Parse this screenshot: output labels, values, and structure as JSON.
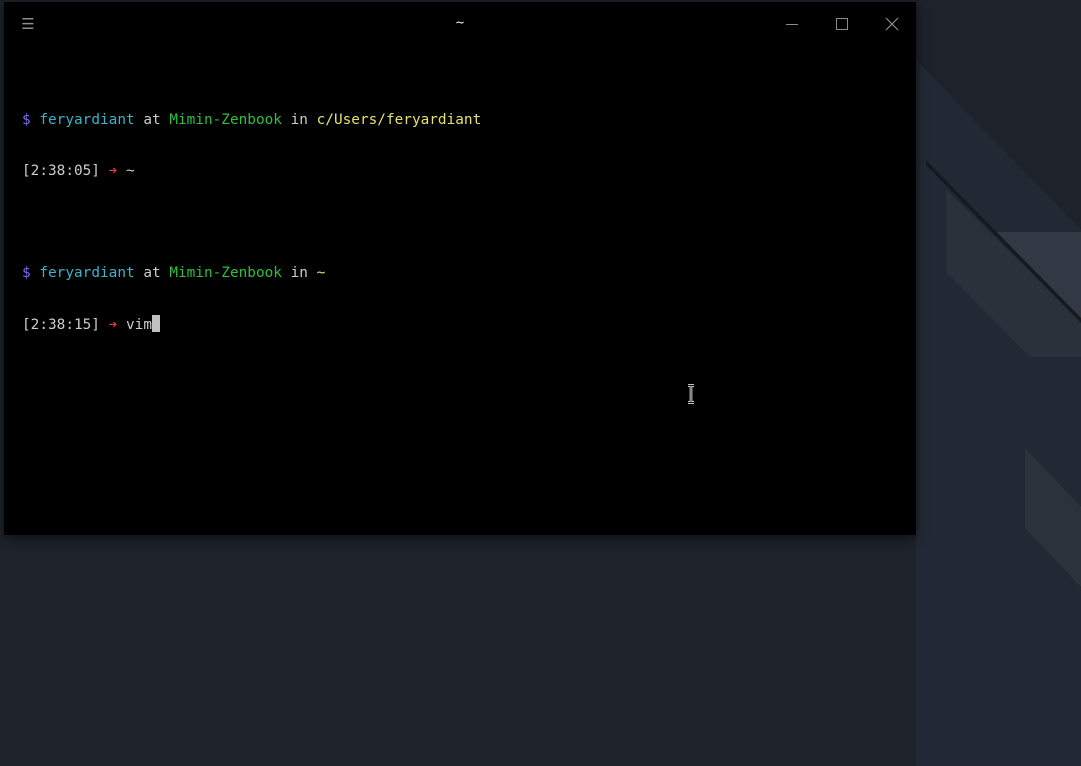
{
  "window": {
    "title": "~",
    "menu_icon": "hamburger-menu-icon",
    "controls": [
      "minimize-icon",
      "maximize-icon",
      "close-icon"
    ]
  },
  "terminal": {
    "prompts": [
      {
        "prompt_symbol": "$",
        "user": "feryardiant",
        "at_word": "at",
        "host": "Mimin-Zenbook",
        "in_word": "in",
        "path": "c/Users/feryardiant",
        "time": "[2:38:05]",
        "arrow": "➔",
        "command": "~"
      },
      {
        "prompt_symbol": "$",
        "user": "feryardiant",
        "at_word": "at",
        "host": "Mimin-Zenbook",
        "in_word": "in",
        "path": "~",
        "time": "[2:38:15]",
        "arrow": "➔",
        "command": "vim"
      }
    ]
  },
  "colors": {
    "background": "#000000",
    "prompt_symbol": "#7a6cf0",
    "user": "#3ab4c8",
    "host": "#2fbf3f",
    "path": "#e5e26b",
    "arrow": "#e8403f",
    "text": "#cccccc",
    "desktop": "#1d222b"
  },
  "cursor_icon": "text-ibeam-cursor-icon"
}
